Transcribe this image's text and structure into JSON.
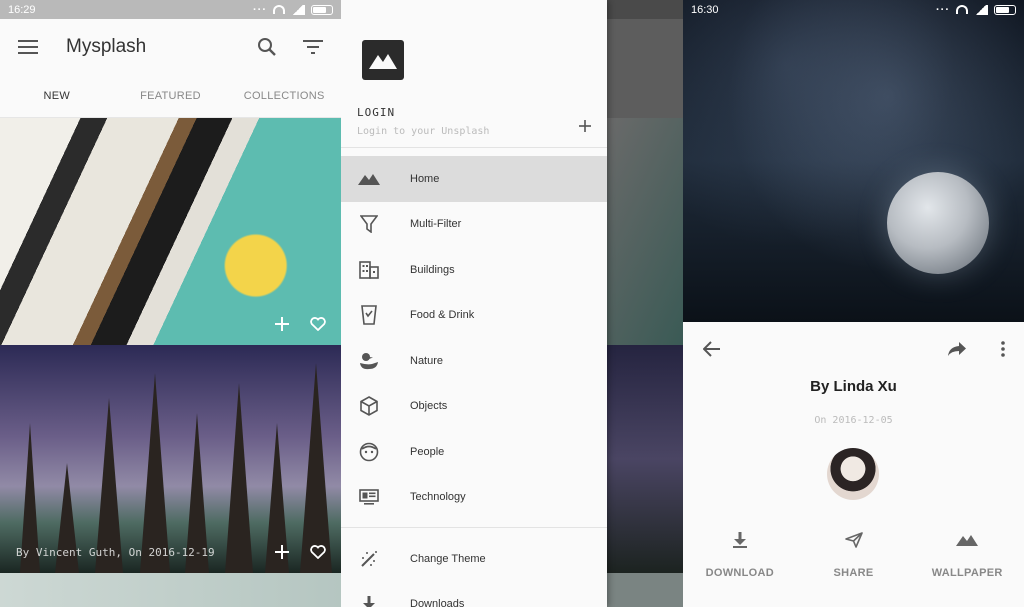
{
  "screen1": {
    "status_time": "16:29",
    "app_title": "Mysplash",
    "tabs": [
      {
        "label": "NEW",
        "active": true
      },
      {
        "label": "FEATURED",
        "active": false
      },
      {
        "label": "COLLECTIONS",
        "active": false
      }
    ],
    "photos": [
      {
        "caption": ""
      },
      {
        "caption": "By Vincent Guth, On 2016-12-19"
      }
    ]
  },
  "screen2": {
    "login_label": "LOGIN",
    "login_sub": "Login to your Unsplash",
    "menu": [
      {
        "label": "Home",
        "icon": "mountain-icon",
        "active": true
      },
      {
        "label": "Multi-Filter",
        "icon": "filter-funnel-icon",
        "active": false
      },
      {
        "label": "Buildings",
        "icon": "building-icon",
        "active": false
      },
      {
        "label": "Food & Drink",
        "icon": "cup-icon",
        "active": false
      },
      {
        "label": "Nature",
        "icon": "duck-icon",
        "active": false
      },
      {
        "label": "Objects",
        "icon": "cube-icon",
        "active": false
      },
      {
        "label": "People",
        "icon": "face-icon",
        "active": false
      },
      {
        "label": "Technology",
        "icon": "monitor-icon",
        "active": false
      }
    ],
    "secondary_menu": [
      {
        "label": "Change Theme",
        "icon": "theme-wand-icon"
      },
      {
        "label": "Downloads",
        "icon": "download-icon"
      }
    ]
  },
  "screen3": {
    "status_time": "16:30",
    "author": "By Linda Xu",
    "date": "On 2016-12-05",
    "actions": [
      {
        "label": "DOWNLOAD",
        "icon": "download-icon"
      },
      {
        "label": "SHARE",
        "icon": "send-icon"
      },
      {
        "label": "WALLPAPER",
        "icon": "mountain-icon"
      }
    ]
  },
  "colors": {
    "background": "#fafafa",
    "text_primary": "#333333",
    "text_secondary": "#888888",
    "menu_active": "#dcdcdc"
  }
}
